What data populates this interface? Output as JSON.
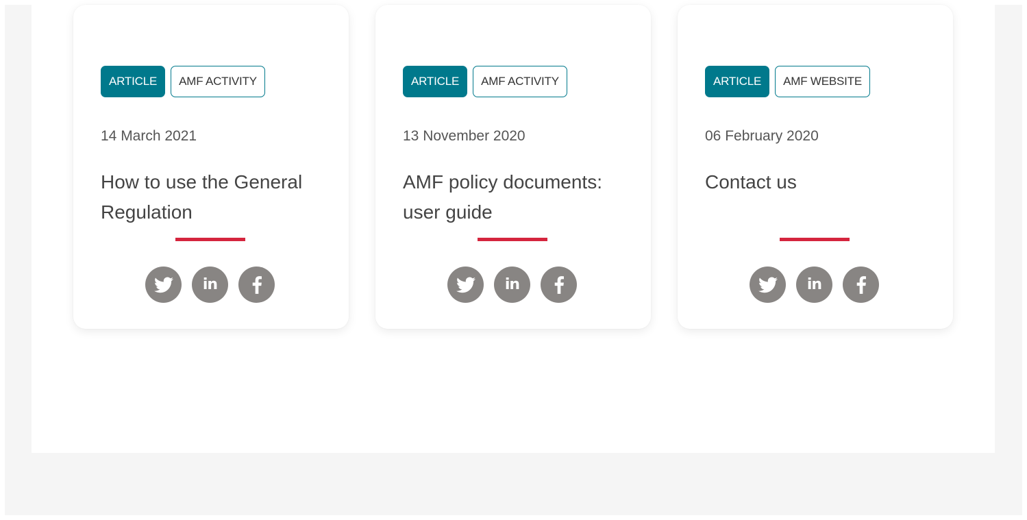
{
  "cards": [
    {
      "tag_primary": "ARTICLE",
      "tag_secondary": "AMF ACTIVITY",
      "date": "14 March 2021",
      "title": "How to use the General Regulation",
      "social": {
        "twitter_icon": "twitter-icon",
        "linkedin_icon": "linkedin-icon",
        "linkedin_text": "in",
        "facebook_icon": "facebook-icon"
      }
    },
    {
      "tag_primary": "ARTICLE",
      "tag_secondary": "AMF ACTIVITY",
      "date": "13 November 2020",
      "title": "AMF policy documents: user guide",
      "social": {
        "twitter_icon": "twitter-icon",
        "linkedin_icon": "linkedin-icon",
        "linkedin_text": "in",
        "facebook_icon": "facebook-icon"
      }
    },
    {
      "tag_primary": "ARTICLE",
      "tag_secondary": "AMF WEBSITE",
      "date": "06 February 2020",
      "title": "Contact us",
      "social": {
        "twitter_icon": "twitter-icon",
        "linkedin_icon": "linkedin-icon",
        "linkedin_text": "in",
        "facebook_icon": "facebook-icon"
      }
    }
  ],
  "colors": {
    "accent_teal": "#00798c",
    "accent_red": "#d5253e",
    "social_gray": "#888583",
    "page_bg": "#f5f5f5"
  }
}
